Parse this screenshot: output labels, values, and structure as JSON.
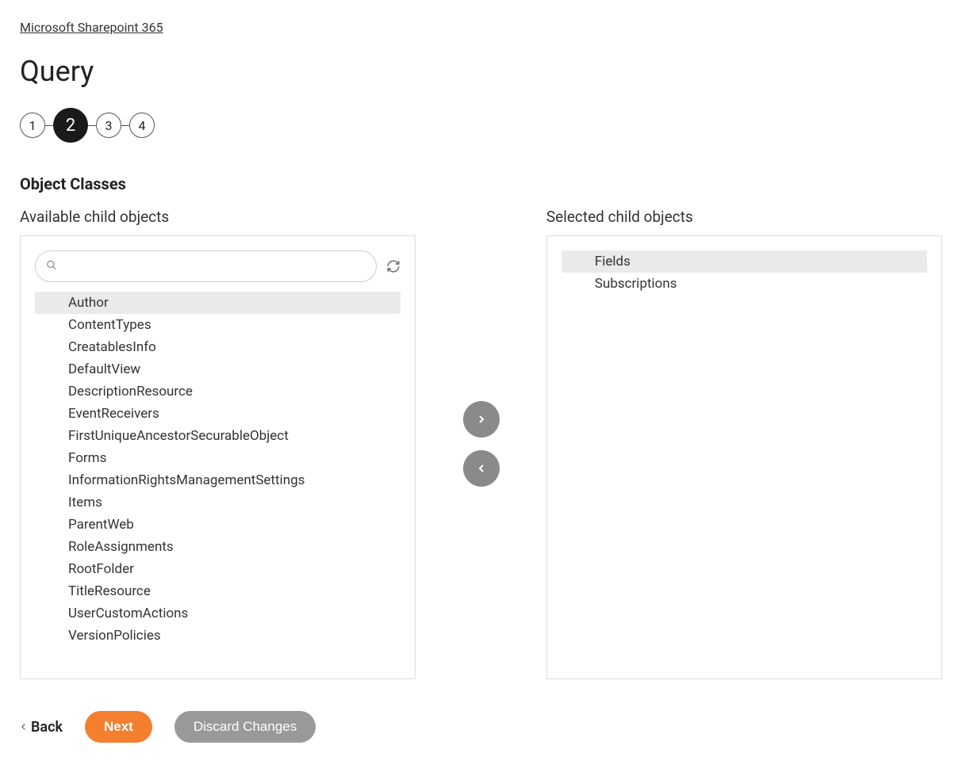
{
  "breadcrumb": "Microsoft Sharepoint 365",
  "page_title": "Query",
  "stepper": {
    "steps": [
      "1",
      "2",
      "3",
      "4"
    ],
    "active_index": 1
  },
  "section_heading": "Object Classes",
  "available": {
    "label": "Available child objects",
    "search_placeholder": "",
    "items": [
      {
        "name": "Author",
        "highlighted": true
      },
      {
        "name": "ContentTypes",
        "highlighted": false
      },
      {
        "name": "CreatablesInfo",
        "highlighted": false
      },
      {
        "name": "DefaultView",
        "highlighted": false
      },
      {
        "name": "DescriptionResource",
        "highlighted": false
      },
      {
        "name": "EventReceivers",
        "highlighted": false
      },
      {
        "name": "FirstUniqueAncestorSecurableObject",
        "highlighted": false
      },
      {
        "name": "Forms",
        "highlighted": false
      },
      {
        "name": "InformationRightsManagementSettings",
        "highlighted": false
      },
      {
        "name": "Items",
        "highlighted": false
      },
      {
        "name": "ParentWeb",
        "highlighted": false
      },
      {
        "name": "RoleAssignments",
        "highlighted": false
      },
      {
        "name": "RootFolder",
        "highlighted": false
      },
      {
        "name": "TitleResource",
        "highlighted": false
      },
      {
        "name": "UserCustomActions",
        "highlighted": false
      },
      {
        "name": "VersionPolicies",
        "highlighted": false
      }
    ]
  },
  "selected": {
    "label": "Selected child objects",
    "items": [
      {
        "name": "Fields",
        "highlighted": true
      },
      {
        "name": "Subscriptions",
        "highlighted": false
      }
    ]
  },
  "buttons": {
    "back": "Back",
    "next": "Next",
    "discard": "Discard Changes"
  }
}
